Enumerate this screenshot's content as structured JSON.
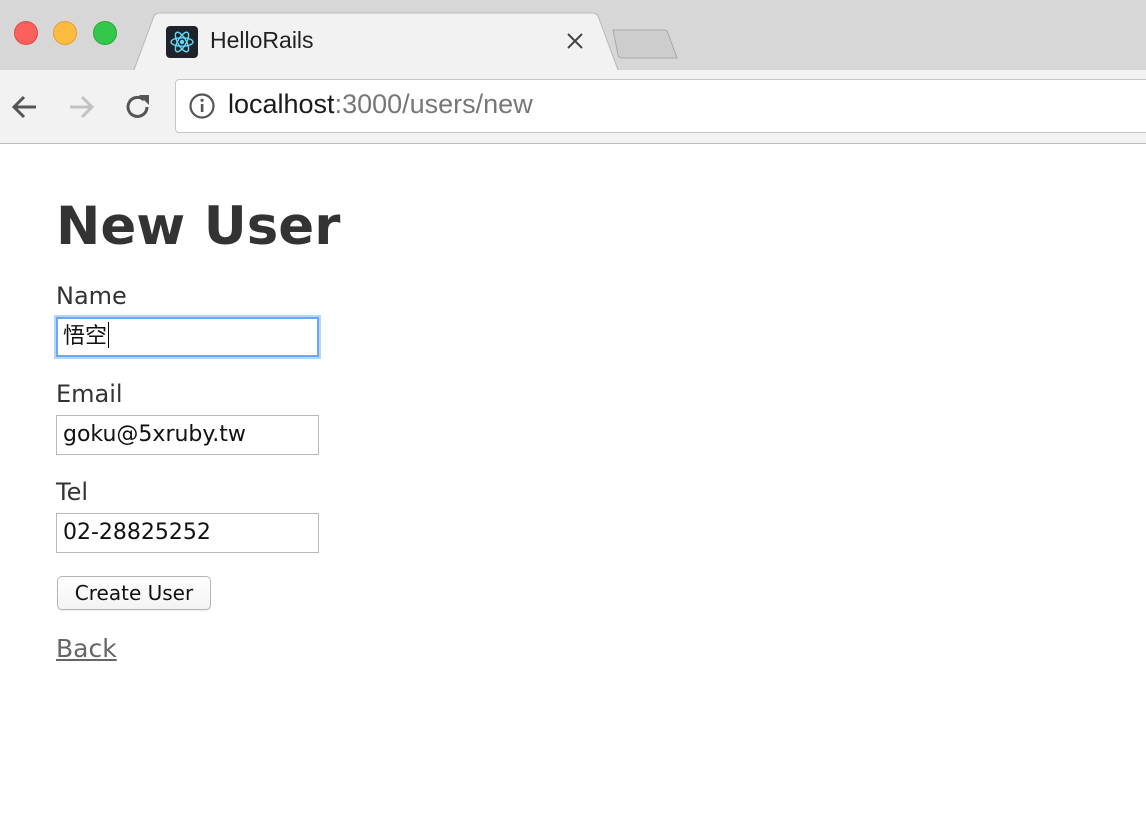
{
  "browser": {
    "tab": {
      "title": "HelloRails",
      "favicon": "react-atom-icon"
    },
    "address_bar": {
      "host": "localhost",
      "rest": ":3000/users/new"
    }
  },
  "page": {
    "heading": "New User",
    "fields": [
      {
        "label": "Name",
        "value": "悟空",
        "focused": true
      },
      {
        "label": "Email",
        "value": "goku@5xruby.tw"
      },
      {
        "label": "Tel",
        "value": "02-28825252"
      }
    ],
    "submit_label": "Create User",
    "back_link": "Back"
  },
  "colors": {
    "heading": "#333333",
    "focus_ring": "#6aa8f5",
    "link": "#666666",
    "favicon_bg": "#20232a",
    "favicon_fg": "#61dafb"
  }
}
